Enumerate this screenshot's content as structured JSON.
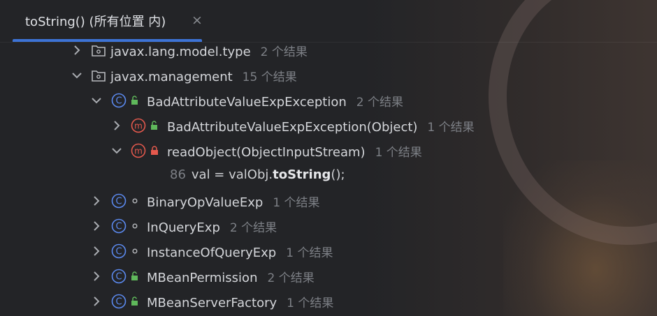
{
  "tab": {
    "title": "toString() (所有位置 内)",
    "close": "×"
  },
  "tree": [
    {
      "label": "javax.lang.model.type",
      "count": "2 个结果"
    },
    {
      "label": "javax.management",
      "count": "15 个结果"
    },
    {
      "label": "BadAttributeValueExpException",
      "count": "2 个结果"
    },
    {
      "label": "BadAttributeValueExpException(Object)",
      "count": "1 个结果"
    },
    {
      "label": "readObject(ObjectInputStream)",
      "count": "1 个结果"
    },
    {
      "line_number": "86",
      "code_before": "val = valObj.",
      "code_match": "toString",
      "code_after": "();"
    },
    {
      "label": "BinaryOpValueExp",
      "count": "1 个结果"
    },
    {
      "label": "InQueryExp",
      "count": "2 个结果"
    },
    {
      "label": "InstanceOfQueryExp",
      "count": "1 个结果"
    },
    {
      "label": "MBeanPermission",
      "count": "2 个结果"
    },
    {
      "label": "MBeanServerFactory",
      "count": "1 个结果"
    }
  ],
  "colors": {
    "accent": "#3d73d6",
    "class_icon": "#5b8af0",
    "method_icon": "#e5594d",
    "public_icon": "#5fb85b",
    "private_icon": "#e5594d"
  }
}
